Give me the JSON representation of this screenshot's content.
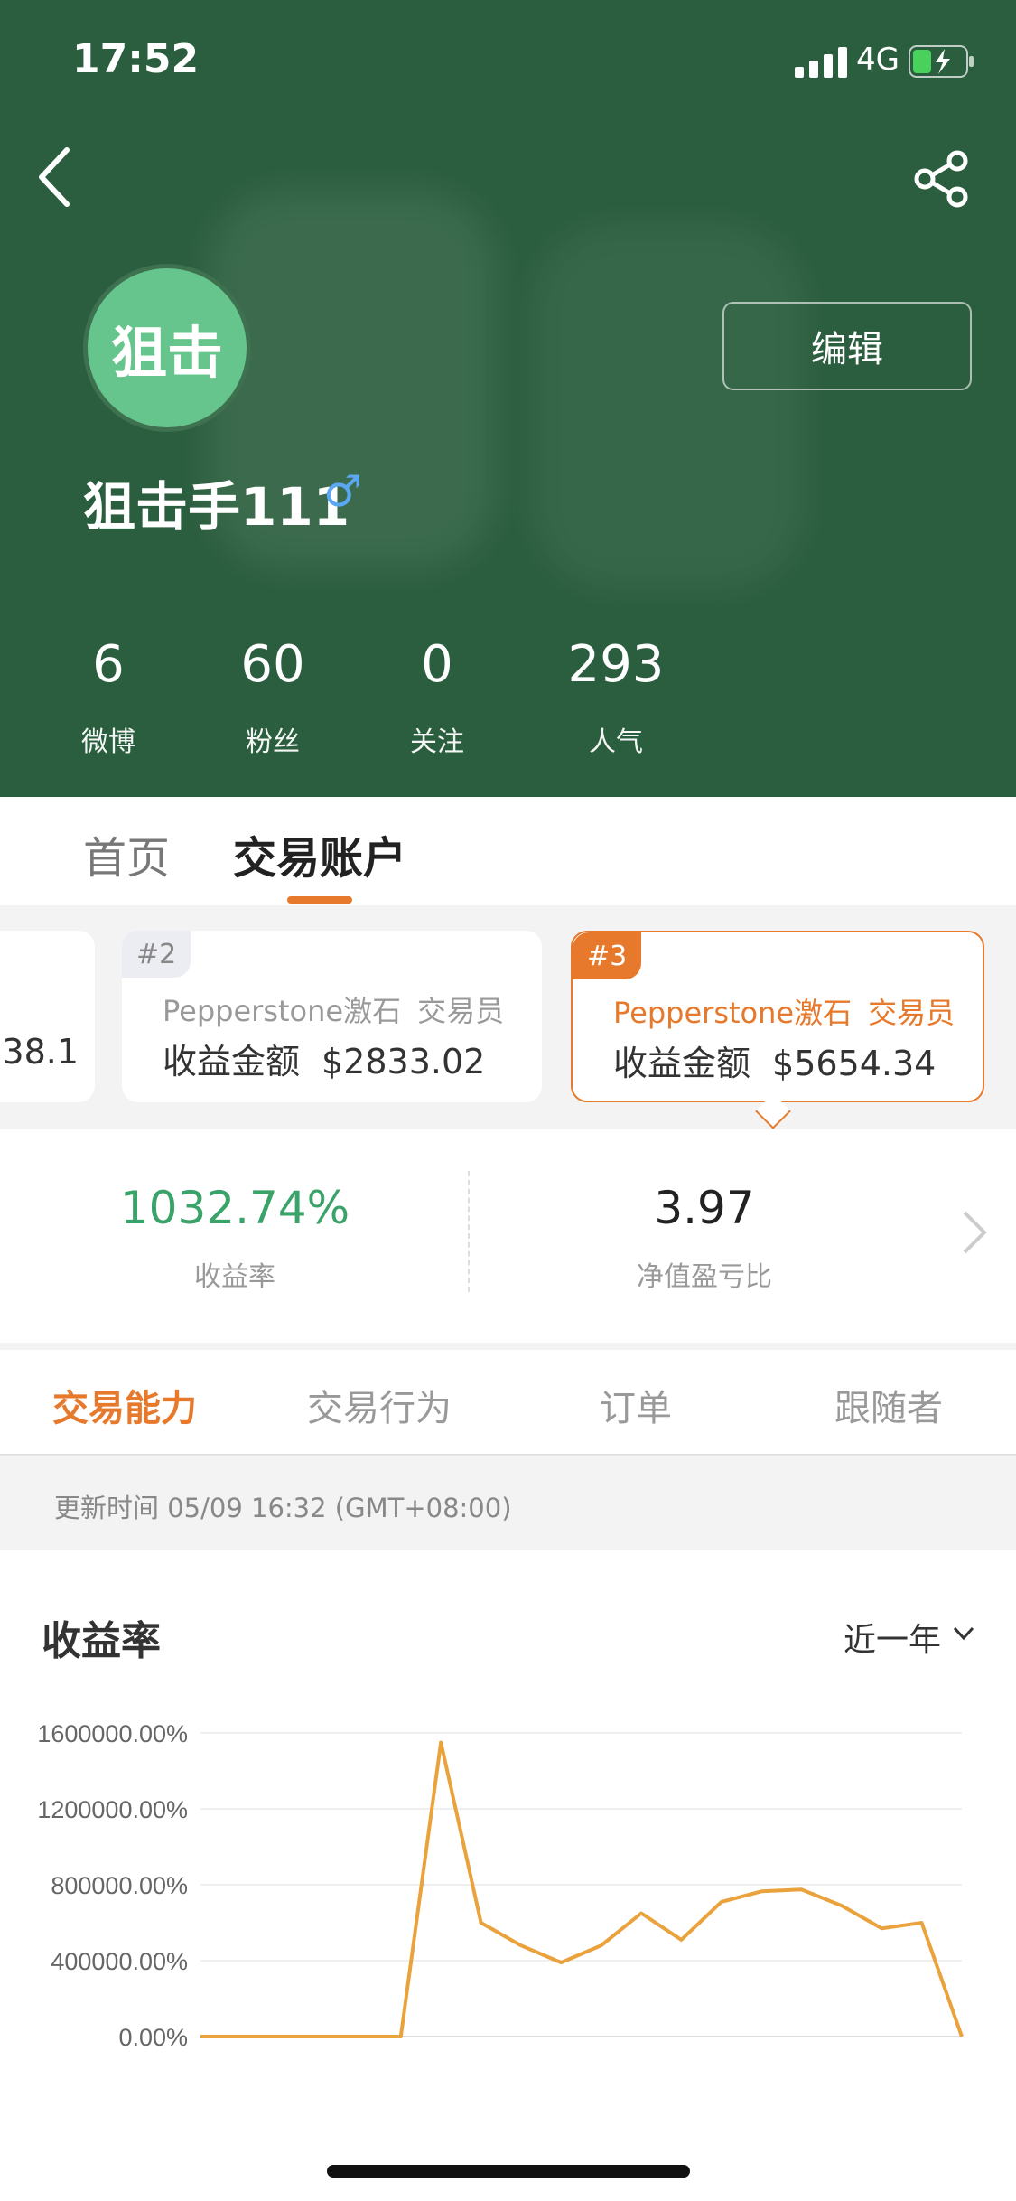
{
  "status_bar": {
    "time": "17:52",
    "network": "4G"
  },
  "profile": {
    "avatar_text": "狙击",
    "username": "狙击手111",
    "gender_symbol": "♂",
    "edit_label": "编辑",
    "stats": [
      {
        "value": "6",
        "label": "微博"
      },
      {
        "value": "60",
        "label": "粉丝"
      },
      {
        "value": "0",
        "label": "关注"
      },
      {
        "value": "293",
        "label": "人气"
      }
    ]
  },
  "main_tabs": [
    {
      "label": "首页"
    },
    {
      "label": "交易账户"
    }
  ],
  "accounts": [
    {
      "amount_partial": "38.1"
    },
    {
      "rank": "#2",
      "broker": "Pepperstone激石",
      "role": "交易员",
      "amount_label": "收益金额",
      "amount": "$2833.02"
    },
    {
      "rank": "#3",
      "broker": "Pepperstone激石",
      "role": "交易员",
      "amount_label": "收益金额",
      "amount": "$5654.34"
    }
  ],
  "metrics": [
    {
      "value": "1032.74%",
      "label": "收益率"
    },
    {
      "value": "3.97",
      "label": "净值盈亏比"
    }
  ],
  "sub_tabs": [
    {
      "label": "交易能力"
    },
    {
      "label": "交易行为"
    },
    {
      "label": "订单"
    },
    {
      "label": "跟随者"
    }
  ],
  "update_text": "更新时间 05/09 16:32 (GMT+08:00)",
  "chart_section": {
    "title": "收益率",
    "period": "近一年"
  },
  "colors": {
    "header_bg": "#2b5e3e",
    "accent": "#e6792b",
    "positive": "#3aa36a",
    "avatar_bg": "#66c58d",
    "line": "#eaa33c"
  },
  "chart_data": {
    "type": "line",
    "title": "",
    "xlabel": "",
    "ylabel": "",
    "ylim": [
      0,
      1600000
    ],
    "y_ticks": [
      "1600000.00%",
      "1200000.00%",
      "800000.00%",
      "400000.00%",
      "0.00%"
    ],
    "y_tick_values": [
      1600000,
      1200000,
      800000,
      400000,
      0
    ],
    "grid": true,
    "series": [
      {
        "values": [
          0,
          0,
          0,
          0,
          0,
          0,
          1550000,
          600000,
          480000,
          390000,
          480000,
          650000,
          510000,
          710000,
          765000,
          775000,
          690000,
          570000,
          600000,
          0
        ]
      }
    ]
  }
}
